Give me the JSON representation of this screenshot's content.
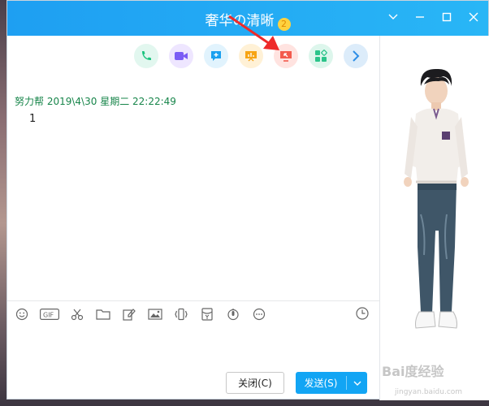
{
  "window": {
    "title": "奢华の清晰",
    "badge": "2",
    "controls": [
      "chevron-down-icon",
      "minimize-icon",
      "maximize-icon",
      "close-icon"
    ]
  },
  "toolbar": {
    "buttons": [
      {
        "name": "voice-call",
        "icon": "phone-icon",
        "bg": "#e2f7ef",
        "fg": "#19c37d"
      },
      {
        "name": "video-call",
        "icon": "video-icon",
        "bg": "#eee6ff",
        "fg": "#7b5cf5"
      },
      {
        "name": "new-chat",
        "icon": "chat-add-icon",
        "bg": "#e1f3fd",
        "fg": "#1aa0ef"
      },
      {
        "name": "presentation",
        "icon": "presentation-icon",
        "bg": "#fff1d6",
        "fg": "#f7a414"
      },
      {
        "name": "remote-assist",
        "icon": "remote-screen-icon",
        "bg": "#ffe3e0",
        "fg": "#f35a4d"
      },
      {
        "name": "apps",
        "icon": "apps-icon",
        "bg": "#ddf6ec",
        "fg": "#2bc48a"
      },
      {
        "name": "more",
        "icon": "chevron-right-icon",
        "bg": "#dcecfa",
        "fg": "#2d8ee6"
      }
    ]
  },
  "message": {
    "sender": "努力帮",
    "timestamp": "2019\\4\\30 星期二 22:22:49",
    "body": "1"
  },
  "input_tools": [
    "emoji-icon",
    "gif-icon",
    "scissors-icon",
    "folder-icon",
    "image-edit-icon",
    "image-icon",
    "shake-icon",
    "red-packet-icon",
    "voice-icon",
    "more-icon"
  ],
  "actions": {
    "close_label": "关闭(C)",
    "send_label": "发送(S)"
  },
  "watermark": {
    "text": "Bai度经验",
    "sub": "jingyan.baidu.com"
  },
  "colors": {
    "titlebar": "#1e9ff2",
    "accent": "#12a5f4",
    "sender": "#17854a",
    "arrow": "#ee2a2a"
  }
}
